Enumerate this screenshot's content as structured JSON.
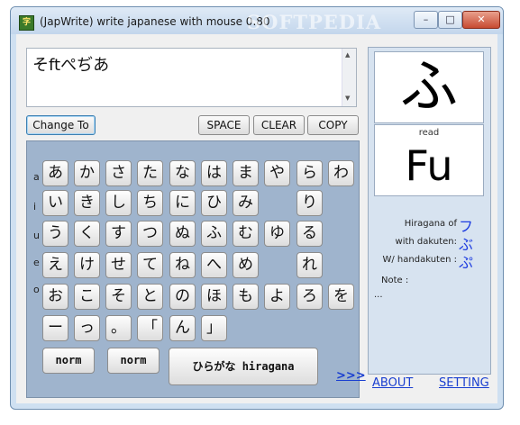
{
  "window": {
    "title": "(JapWrite) write japanese with mouse 0.80",
    "watermark": "SOFTPEDIA",
    "icon_name": "japwrite-app-icon",
    "controls": {
      "minimize": "–",
      "maximize": "□",
      "close": "✕"
    }
  },
  "text_area": {
    "value": "そftぺぢあ",
    "scroll_up": "▲",
    "scroll_down": "▼"
  },
  "buttons": {
    "change_to": "Change To",
    "space": "SPACE",
    "clear": "CLEAR",
    "copy": "COPY"
  },
  "vowels": [
    "a",
    "i",
    "u",
    "e",
    "o"
  ],
  "kana_rows": [
    [
      "あ",
      "か",
      "さ",
      "た",
      "な",
      "は",
      "ま",
      "や",
      "ら",
      "わ"
    ],
    [
      "い",
      "き",
      "し",
      "ち",
      "に",
      "ひ",
      "み",
      "",
      "り",
      ""
    ],
    [
      "う",
      "く",
      "す",
      "つ",
      "ぬ",
      "ふ",
      "む",
      "ゆ",
      "る",
      ""
    ],
    [
      "え",
      "け",
      "せ",
      "て",
      "ね",
      "へ",
      "め",
      "",
      "れ",
      ""
    ],
    [
      "お",
      "こ",
      "そ",
      "と",
      "の",
      "ほ",
      "も",
      "よ",
      "ろ",
      "を"
    ],
    [
      "ー",
      "っ",
      "。",
      "「",
      "ん",
      "」"
    ]
  ],
  "mode_buttons": {
    "norm1": "norm",
    "norm2": "norm",
    "script": "ひらがな hiragana",
    "more": ">>>"
  },
  "preview": {
    "character": "ふ",
    "read_label": "read",
    "romaji": "Fu",
    "hiragana_of_label": "Hiragana of",
    "hiragana_of": "フ",
    "dakuten_label": "with dakuten:",
    "dakuten": "ぶ",
    "handakuten_label": "W/ handakuten :",
    "handakuten": "ぷ",
    "note_label": "Note :",
    "note_value": "..."
  },
  "links": {
    "about": "ABOUT",
    "setting": "SETTING"
  },
  "colors": {
    "keyboard_bg": "#9fb4cd",
    "link": "#1a3fd0",
    "kana_variant": "#1e3de0"
  }
}
